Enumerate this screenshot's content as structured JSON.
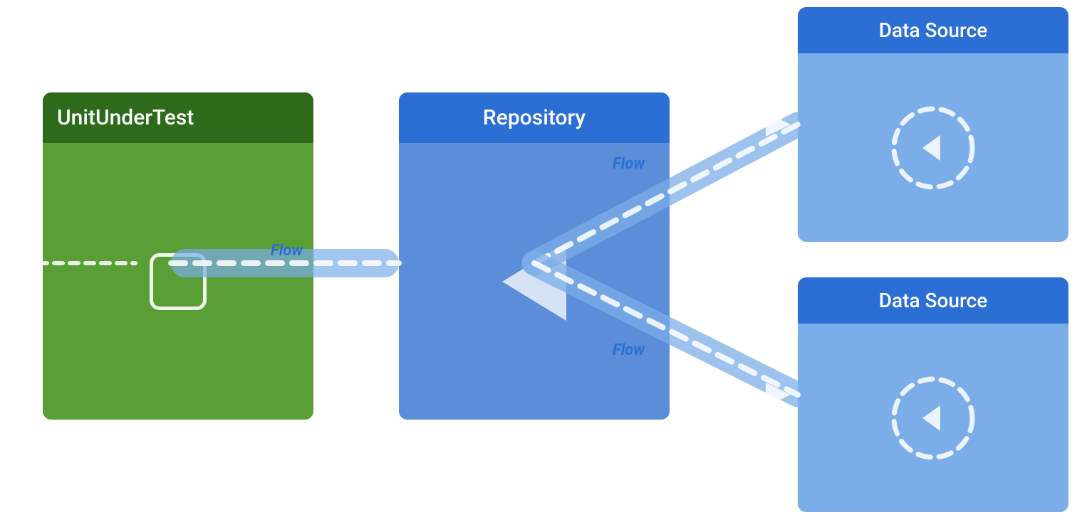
{
  "diagram": {
    "unit_under_test": {
      "title": "UnitUnderTest",
      "body_bg": "#5a9e36",
      "header_bg": "#2d6b1a"
    },
    "repository": {
      "title": "Repository",
      "header_bg": "#2b6fd4",
      "body_bg": "#5b8dd9"
    },
    "data_source_top": {
      "title": "Data Source",
      "header_bg": "#2b6fd4",
      "body_bg": "#7baee8"
    },
    "data_source_bottom": {
      "title": "Data Source",
      "header_bg": "#2b6fd4",
      "body_bg": "#7baee8"
    },
    "flow_labels": {
      "flow1": "Flow",
      "flow2": "Flow",
      "flow3": "Flow"
    },
    "colors": {
      "accent": "#2b6fd4",
      "green_dark": "#2d6b1a",
      "green_main": "#5a9e36",
      "blue_main": "#5b8dd9",
      "blue_light": "#7baee8",
      "white": "#ffffff",
      "dashed_line": "#c8daf7"
    }
  }
}
